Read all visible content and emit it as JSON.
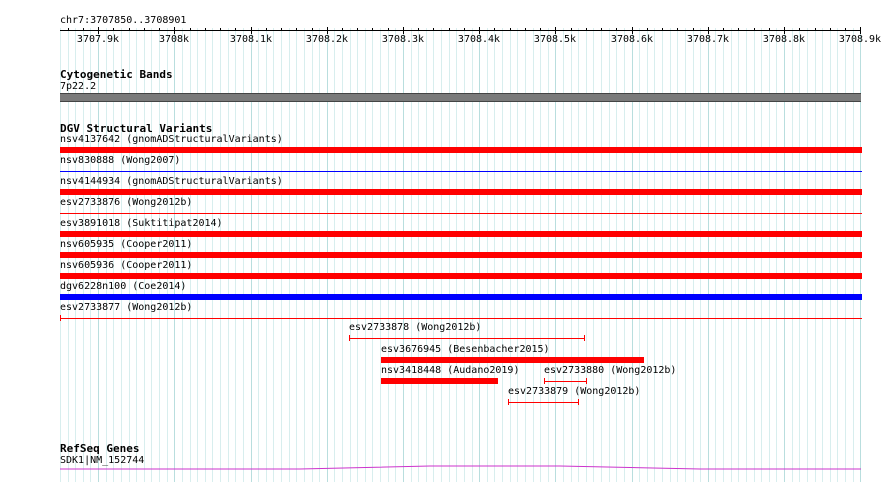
{
  "ruler": {
    "locus": "chr7:3707850..3708901",
    "start": 3707850,
    "end": 3708901,
    "ticks": [
      "3707.9k",
      "3708k",
      "3708.1k",
      "3708.2k",
      "3708.3k",
      "3708.4k",
      "3708.5k",
      "3708.6k",
      "3708.7k",
      "3708.8k",
      "3708.9k"
    ],
    "tick_values": [
      3707900,
      3708000,
      3708100,
      3708200,
      3708300,
      3708400,
      3708500,
      3708600,
      3708700,
      3708800,
      3708900
    ]
  },
  "cytoband": {
    "title": "Cytogenetic Bands",
    "label": "7p22.2",
    "color": "#7a7a7a"
  },
  "dgv": {
    "title": "DGV Structural Variants",
    "colors": {
      "loss": "#ff0000",
      "gain": "#0000ff",
      "thin_red": "#ff0000",
      "thin_blue": "#0000ff"
    },
    "full_rows": [
      {
        "label": "nsv4137642 (gnomADStructuralVariants)",
        "style": "thick",
        "color": "#ff0000"
      },
      {
        "label": "nsv830888 (Wong2007)",
        "style": "thin",
        "color": "#0000ff"
      },
      {
        "label": "nsv4144934 (gnomADStructuralVariants)",
        "style": "thick",
        "color": "#ff0000"
      },
      {
        "label": "esv2733876 (Wong2012b)",
        "style": "thin",
        "color": "#ff0000"
      },
      {
        "label": "esv3891018 (Suktitipat2014)",
        "style": "thick",
        "color": "#ff0000"
      },
      {
        "label": "nsv605935 (Cooper2011)",
        "style": "thick",
        "color": "#ff0000"
      },
      {
        "label": "nsv605936 (Cooper2011)",
        "style": "thick",
        "color": "#ff0000"
      },
      {
        "label": "dgv6228n100 (Coe2014)",
        "style": "thick",
        "color": "#0000ff"
      },
      {
        "label": "esv2733877 (Wong2012b)",
        "style": "thin",
        "color": "#ff0000"
      }
    ],
    "partial_rows": [
      {
        "label": "esv2733878 (Wong2012b)",
        "style": "range",
        "color": "#ff0000",
        "start": 3708229,
        "end": 3708537
      },
      {
        "label": "esv3676945 (Besenbacher2015)",
        "style": "thick",
        "color": "#ff0000",
        "start": 3708271,
        "end": 3708616
      },
      {
        "label": "nsv3418448 (Audano2019)",
        "style": "thick",
        "color": "#ff0000",
        "start": 3708271,
        "end": 3708425
      },
      {
        "label": "esv2733880 (Wong2012b)",
        "style": "range",
        "color": "#ff0000",
        "start": 3708485,
        "end": 3708540
      },
      {
        "label": "esv2733879 (Wong2012b)",
        "style": "range",
        "color": "#ff0000",
        "start": 3708438,
        "end": 3708530
      }
    ]
  },
  "refseq": {
    "title": "RefSeq Genes",
    "label": "SDK1|NM_152744",
    "color": "#cc33cc"
  }
}
